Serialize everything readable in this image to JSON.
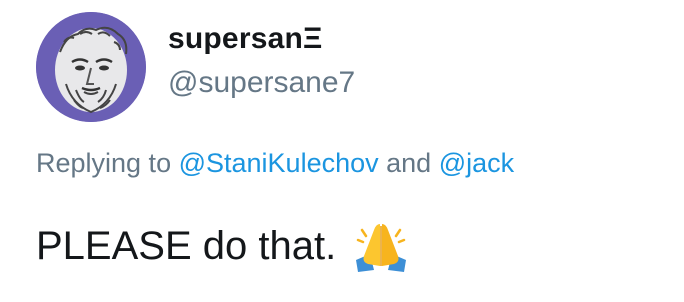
{
  "tweet": {
    "author": {
      "display_name": "supersanΞ",
      "handle": "@supersane7",
      "avatar_icon": "greek-god-statue-avatar"
    },
    "reply_context": {
      "prefix": "Replying to ",
      "mention_1": "@StaniKulechov",
      "conjunction": " and ",
      "mention_2": "@jack"
    },
    "text": "PLEASE do that.",
    "emoji_icon": "folded-hands-emoji"
  },
  "colors": {
    "text_primary": "#14171a",
    "text_secondary": "#657786",
    "link": "#1b95e0",
    "avatar_bg": "#6a5fb5"
  }
}
